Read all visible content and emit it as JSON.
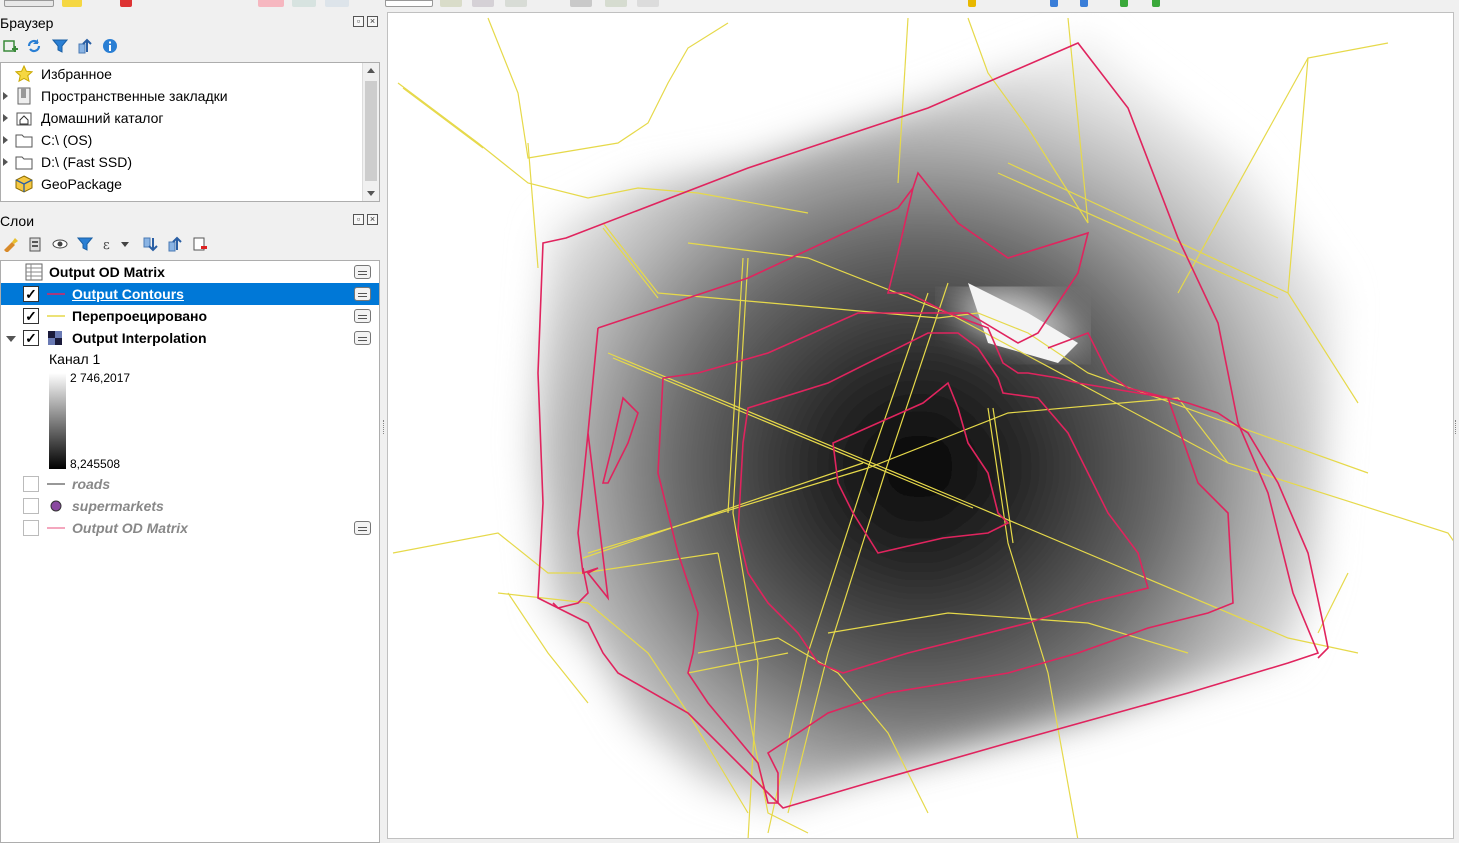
{
  "browser_panel": {
    "title": "Браузер",
    "toolbar_icons": [
      "add-layer-icon",
      "refresh-icon",
      "filter-icon",
      "collapse-all-icon",
      "info-icon"
    ],
    "items": [
      {
        "label": "Избранное",
        "icon": "star-icon",
        "expandable": false
      },
      {
        "label": "Пространственные закладки",
        "icon": "bookmark-icon",
        "expandable": true
      },
      {
        "label": "Домашний каталог",
        "icon": "home-folder-icon",
        "expandable": true
      },
      {
        "label": "C:\\ (OS)",
        "icon": "folder-icon",
        "expandable": true
      },
      {
        "label": "D:\\ (Fast SSD)",
        "icon": "folder-icon",
        "expandable": true
      },
      {
        "label": "GeoPackage",
        "icon": "geopackage-icon",
        "expandable": false
      }
    ]
  },
  "layers_panel": {
    "title": "Слои",
    "toolbar_icons": [
      "style-icon",
      "add-group-icon",
      "manage-visibility-icon",
      "filter-legend-icon",
      "expression-filter-icon",
      "expand-all-icon",
      "collapse-all-icon",
      "remove-layer-icon"
    ],
    "layers": [
      {
        "name": "Output OD Matrix",
        "checked": null,
        "enabled": true,
        "selected": false,
        "symbol": "table"
      },
      {
        "name": "Output Contours",
        "checked": true,
        "enabled": true,
        "selected": true,
        "symbol": "line-crimson"
      },
      {
        "name": "Перепроецировано",
        "checked": true,
        "enabled": true,
        "selected": false,
        "symbol": "line-yellow"
      },
      {
        "name": "Output Interpolation",
        "checked": true,
        "enabled": true,
        "selected": false,
        "symbol": "raster"
      },
      {
        "name": "roads",
        "checked": false,
        "enabled": false,
        "selected": false,
        "symbol": "line-gray"
      },
      {
        "name": "supermarkets",
        "checked": false,
        "enabled": false,
        "selected": false,
        "symbol": "point-purple"
      },
      {
        "name": "Output OD Matrix",
        "checked": false,
        "enabled": false,
        "selected": false,
        "symbol": "line-pink"
      }
    ],
    "raster_legend": {
      "band": "Канал 1",
      "max": "2 746,2017",
      "min": "8,245508"
    }
  },
  "colors": {
    "contour": "#e0245e",
    "roads": "#e6d94a",
    "selection": "#0078d7"
  }
}
